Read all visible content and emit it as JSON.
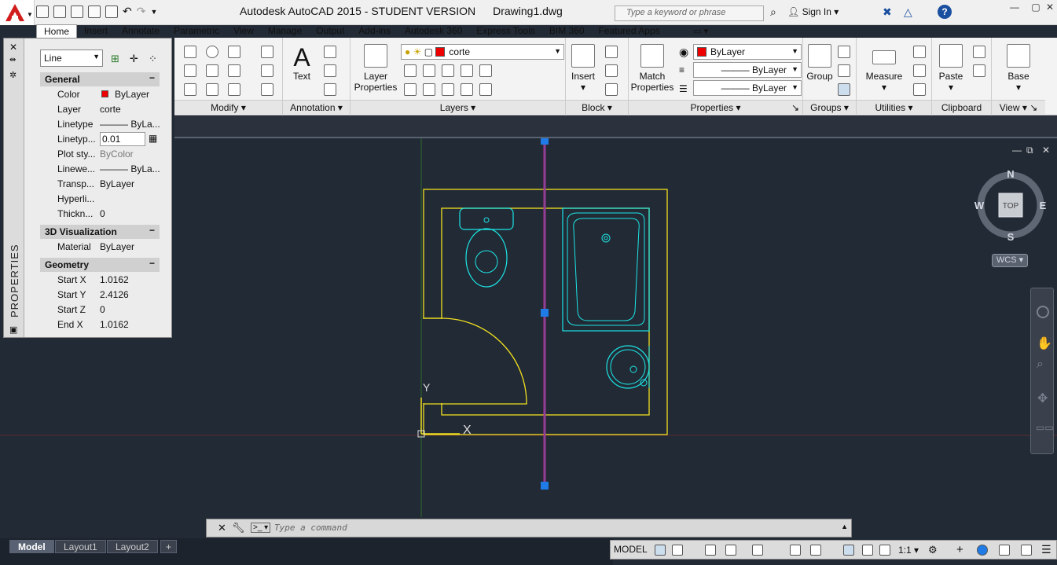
{
  "window": {
    "title": "Autodesk AutoCAD 2015 - STUDENT VERSION",
    "file": "Drawing1.dwg",
    "search_placeholder": "Type a keyword or phrase",
    "sign_in": "Sign In"
  },
  "ribbon_tabs": [
    "Home",
    "Insert",
    "Annotate",
    "Parametric",
    "View",
    "Manage",
    "Output",
    "Add-ins",
    "Autodesk 360",
    "Express Tools",
    "BIM 360",
    "Featured Apps"
  ],
  "ribbon": {
    "modify": "Modify",
    "annotation": "Annotation",
    "text_btn": "Text",
    "layers": "Layers",
    "layer_props": [
      "Layer",
      "Properties"
    ],
    "layer_current": "corte",
    "block": "Block",
    "insert": "Insert",
    "properties": "Properties",
    "match": [
      "Match",
      "Properties"
    ],
    "color_combo": "ByLayer",
    "linetype_combo": "ByLayer",
    "lineweight_combo": "ByLayer",
    "groups": "Groups",
    "group_btn": "Group",
    "utilities": "Utilities",
    "measure": "Measure",
    "clipboard": "Clipboard",
    "paste": "Paste",
    "view": "View",
    "base": "Base"
  },
  "properties_palette": {
    "side_label": "PROPERTIES",
    "selection": "Line",
    "general": "General",
    "rows_general": [
      {
        "k": "Color",
        "v": "ByLayer"
      },
      {
        "k": "Layer",
        "v": "corte"
      },
      {
        "k": "Linetype",
        "v": "——— ByLa..."
      },
      {
        "k": "Linetyp...",
        "v": "0.01"
      },
      {
        "k": "Plot sty...",
        "v": "ByColor"
      },
      {
        "k": "Linewe...",
        "v": "——— ByLa..."
      },
      {
        "k": "Transp...",
        "v": "ByLayer"
      },
      {
        "k": "Hyperli...",
        "v": ""
      },
      {
        "k": "Thickn...",
        "v": "0"
      }
    ],
    "viz": "3D Visualization",
    "rows_viz": [
      {
        "k": "Material",
        "v": "ByLayer"
      }
    ],
    "geometry": "Geometry",
    "rows_geom": [
      {
        "k": "Start X",
        "v": "1.0162"
      },
      {
        "k": "Start Y",
        "v": "2.4126"
      },
      {
        "k": "Start Z",
        "v": "0"
      },
      {
        "k": "End X",
        "v": "1.0162"
      }
    ]
  },
  "viewcube": {
    "n": "N",
    "s": "S",
    "e": "E",
    "w": "W",
    "top": "TOP",
    "wcs": "WCS"
  },
  "ucs": {
    "x": "X",
    "y": "Y"
  },
  "command": {
    "placeholder": "Type a command"
  },
  "layout_tabs": [
    "Model",
    "Layout1",
    "Layout2"
  ],
  "status": {
    "model": "MODEL",
    "scale": "1:1"
  },
  "colors": {
    "drawing_yellow": "#f0e020",
    "drawing_cyan": "#1ce6e6",
    "selected_line": "#c0308a",
    "grip": "#1f7be6",
    "canvas": "#222a35"
  }
}
